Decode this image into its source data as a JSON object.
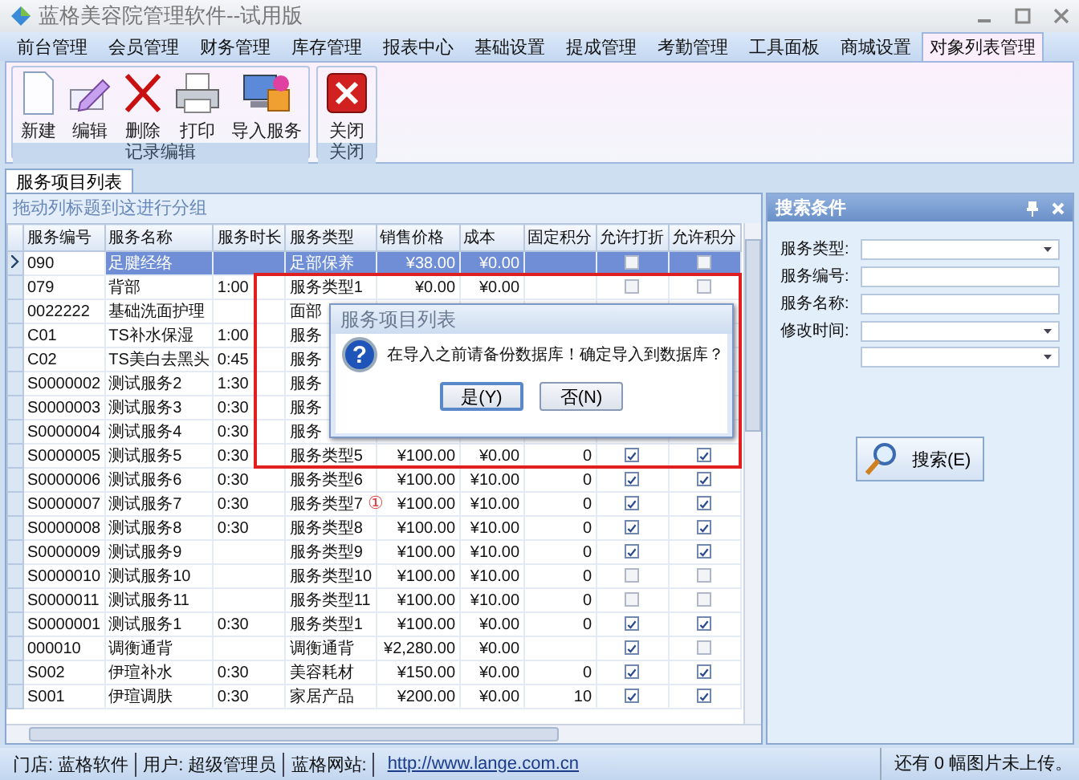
{
  "window": {
    "title": "蓝格美容院管理软件--试用版"
  },
  "menu_tabs": [
    {
      "label": "前台管理",
      "selected": false
    },
    {
      "label": "会员管理",
      "selected": false
    },
    {
      "label": "财务管理",
      "selected": false
    },
    {
      "label": "库存管理",
      "selected": false
    },
    {
      "label": "报表中心",
      "selected": false
    },
    {
      "label": "基础设置",
      "selected": false
    },
    {
      "label": "提成管理",
      "selected": false
    },
    {
      "label": "考勤管理",
      "selected": false
    },
    {
      "label": "工具面板",
      "selected": false
    },
    {
      "label": "商城设置",
      "selected": false
    },
    {
      "label": "对象列表管理",
      "selected": true
    }
  ],
  "ribbon_groups": [
    {
      "title": "记录编辑",
      "buttons": [
        {
          "label": "新建",
          "kind": "new"
        },
        {
          "label": "编辑",
          "kind": "edit"
        },
        {
          "label": "删除",
          "kind": "delete"
        },
        {
          "label": "打印",
          "kind": "print"
        },
        {
          "label": "导入服务",
          "kind": "import"
        }
      ]
    },
    {
      "title": "关闭",
      "buttons": [
        {
          "label": "关闭",
          "kind": "close"
        }
      ]
    }
  ],
  "document_tab": {
    "label": "服务项目列表"
  },
  "group_panel": {
    "hint": "拖动列标题到这进行分组"
  },
  "table": {
    "columns": [
      "服务编号",
      "服务名称",
      "服务时长",
      "服务类型",
      "销售价格",
      "成本",
      "固定积分",
      "允许打折",
      "允许积分"
    ],
    "rows": [
      {
        "code": "090",
        "name": "足腱经络",
        "duration": "",
        "type": "足部保养",
        "price": "¥38.00",
        "cost": "¥0.00",
        "points": "",
        "discount": false,
        "allow_points": false,
        "selected": true
      },
      {
        "code": "079",
        "name": "背部",
        "duration": "1:00",
        "type": "服务类型1",
        "price": "¥0.00",
        "cost": "¥0.00",
        "points": "",
        "discount": false,
        "allow_points": false,
        "selected": false
      },
      {
        "code": "0022222",
        "name": "基础洗面护理",
        "duration": "",
        "type": "面部",
        "selected": false
      },
      {
        "code": "C01",
        "name": "TS补水保湿",
        "duration": "1:00",
        "type": "服务",
        "selected": false
      },
      {
        "code": "C02",
        "name": "TS美白去黑头",
        "duration": "0:45",
        "type": "服务",
        "selected": false
      },
      {
        "code": "S0000002",
        "name": "测试服务2",
        "duration": "1:30",
        "type": "服务",
        "selected": false
      },
      {
        "code": "S0000003",
        "name": "测试服务3",
        "duration": "0:30",
        "type": "服务",
        "selected": false
      },
      {
        "code": "S0000004",
        "name": "测试服务4",
        "duration": "0:30",
        "type": "服务",
        "selected": false
      },
      {
        "code": "S0000005",
        "name": "测试服务5",
        "duration": "0:30",
        "type": "服务类型5",
        "price": "¥100.00",
        "cost": "¥0.00",
        "points": "0",
        "discount": true,
        "allow_points": true,
        "selected": false
      },
      {
        "code": "S0000006",
        "name": "测试服务6",
        "duration": "0:30",
        "type": "服务类型6",
        "price": "¥100.00",
        "cost": "¥10.00",
        "points": "0",
        "discount": true,
        "allow_points": true,
        "selected": false
      },
      {
        "code": "S0000007",
        "name": "测试服务7",
        "duration": "0:30",
        "type": "服务类型7",
        "price": "¥100.00",
        "cost": "¥10.00",
        "points": "0",
        "discount": true,
        "allow_points": true,
        "selected": false
      },
      {
        "code": "S0000008",
        "name": "测试服务8",
        "duration": "0:30",
        "type": "服务类型8",
        "price": "¥100.00",
        "cost": "¥10.00",
        "points": "0",
        "discount": true,
        "allow_points": true,
        "selected": false
      },
      {
        "code": "S0000009",
        "name": "测试服务9",
        "duration": "",
        "type": "服务类型9",
        "price": "¥100.00",
        "cost": "¥10.00",
        "points": "0",
        "discount": true,
        "allow_points": true,
        "selected": false
      },
      {
        "code": "S0000010",
        "name": "测试服务10",
        "duration": "",
        "type": "服务类型10",
        "price": "¥100.00",
        "cost": "¥10.00",
        "points": "0",
        "discount": false,
        "allow_points": false,
        "selected": false
      },
      {
        "code": "S0000011",
        "name": "测试服务11",
        "duration": "",
        "type": "服务类型11",
        "price": "¥100.00",
        "cost": "¥10.00",
        "points": "0",
        "discount": false,
        "allow_points": false,
        "selected": false
      },
      {
        "code": "S0000001",
        "name": "测试服务1",
        "duration": "0:30",
        "type": "服务类型1",
        "price": "¥100.00",
        "cost": "¥0.00",
        "points": "0",
        "discount": true,
        "allow_points": true,
        "selected": false
      },
      {
        "code": "000010",
        "name": "调衡通背",
        "duration": "",
        "type": "调衡通背",
        "price": "¥2,280.00",
        "cost": "¥0.00",
        "points": "",
        "discount": true,
        "allow_points": false,
        "selected": false
      },
      {
        "code": "S002",
        "name": "伊瑄补水",
        "duration": "0:30",
        "type": "美容耗材",
        "price": "¥150.00",
        "cost": "¥0.00",
        "points": "0",
        "discount": true,
        "allow_points": true,
        "selected": false
      },
      {
        "code": "S001",
        "name": "伊瑄调肤",
        "duration": "0:30",
        "type": "家居产品",
        "price": "¥200.00",
        "cost": "¥0.00",
        "points": "10",
        "discount": true,
        "allow_points": true,
        "selected": false
      }
    ]
  },
  "dialog": {
    "title": "服务项目列表",
    "icon": "?",
    "message": "在导入之前请备份数据库！确定导入到数据库？",
    "buttons": [
      {
        "label": "是(Y)",
        "selected": true
      },
      {
        "label": "否(N)",
        "selected": false
      }
    ]
  },
  "annotation": {
    "marker": "①"
  },
  "search_panel": {
    "title": "搜索条件",
    "fields": [
      {
        "label": "服务类型:",
        "kind": "combo"
      },
      {
        "label": "服务编号:",
        "kind": "text"
      },
      {
        "label": "服务名称:",
        "kind": "text"
      },
      {
        "label": "修改时间:",
        "kind": "combo"
      },
      {
        "kind": "combo"
      }
    ],
    "button": "搜索(E)"
  },
  "status_bar": {
    "items": [
      "门店: 蓝格软件",
      "用户: 超级管理员",
      "蓝格网站:"
    ],
    "link": "http://www.lange.com.cn",
    "right": "还有 0 幅图片未上传。"
  }
}
